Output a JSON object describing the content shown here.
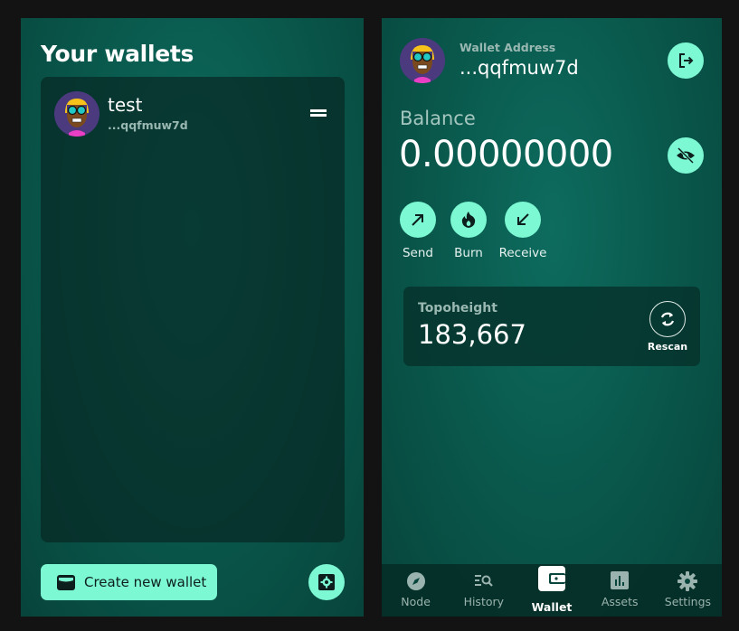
{
  "left_panel": {
    "title": "Your wallets",
    "wallets": [
      {
        "name": "test",
        "address": "...qqfmuw7d",
        "avatar": "avatar-glasses-blonde"
      }
    ],
    "create_button_label": "Create new wallet",
    "create_button_icon": "wallet-icon",
    "settings_icon": "settings-icon"
  },
  "right_panel": {
    "header": {
      "address_label": "Wallet Address",
      "address_value": "...qqfmuw7d",
      "logout_icon": "logout-icon"
    },
    "balance": {
      "label": "Balance",
      "value": "0.00000000",
      "hide_icon": "eye-off-icon"
    },
    "actions": [
      {
        "label": "Send",
        "icon": "arrow-up-right-icon"
      },
      {
        "label": "Burn",
        "icon": "fire-icon"
      },
      {
        "label": "Receive",
        "icon": "arrow-down-left-icon"
      }
    ],
    "topoheight": {
      "label": "Topoheight",
      "value": "183,667",
      "rescan_label": "Rescan"
    },
    "nav": [
      {
        "label": "Node",
        "icon": "compass-icon",
        "active": false
      },
      {
        "label": "History",
        "icon": "history-search-icon",
        "active": false
      },
      {
        "label": "Wallet",
        "icon": "wallet-icon",
        "active": true
      },
      {
        "label": "Assets",
        "icon": "chart-icon",
        "active": false
      },
      {
        "label": "Settings",
        "icon": "gear-icon",
        "active": false
      }
    ]
  },
  "colors": {
    "accent": "#7cf8d2",
    "panel_bg": "#0a5a4e",
    "page_bg": "#131313"
  }
}
